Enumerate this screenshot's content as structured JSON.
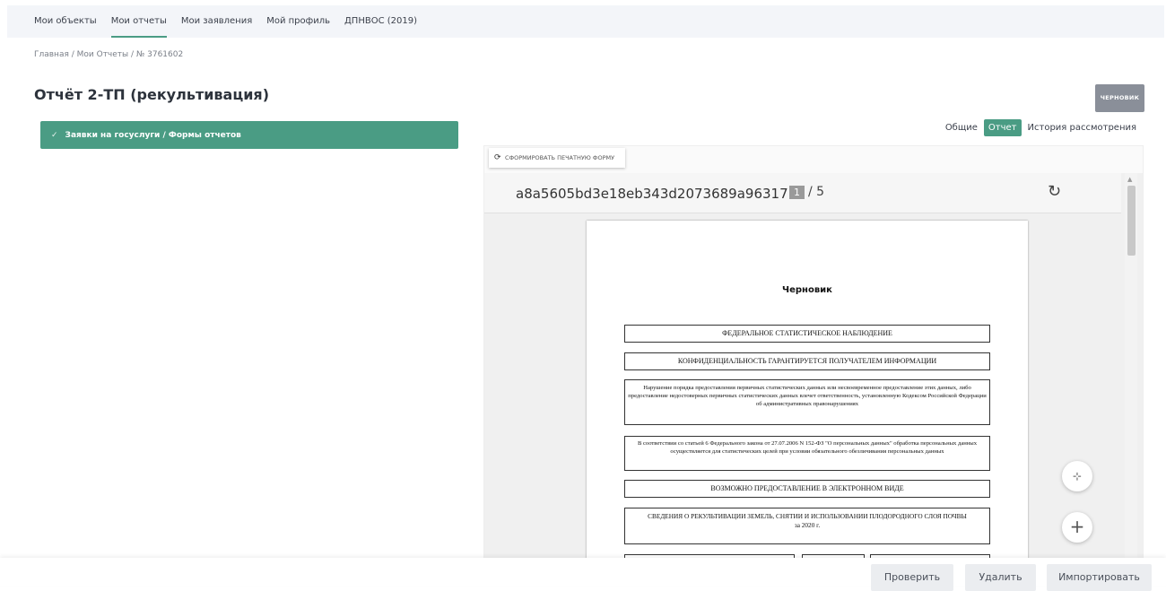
{
  "nav": {
    "items": [
      {
        "label": "Мои объекты"
      },
      {
        "label": "Мои отчеты"
      },
      {
        "label": "Мои заявления"
      },
      {
        "label": "Мой профиль"
      },
      {
        "label": "ДПНВОС (2019)"
      }
    ],
    "active_index": 1
  },
  "breadcrumb": "Главная / Мои Отчеты / № 3761602",
  "page_title": "Отчёт 2-ТП (рекультивация)",
  "status_button": "ЧЕРНОВИК",
  "section_bar": {
    "label": "Заявки на госуслуги / Формы отчетов",
    "icon": "check-icon"
  },
  "tabs": [
    {
      "label": "Общие"
    },
    {
      "label": "Отчет",
      "active": true
    },
    {
      "label": "История рассмотрения"
    }
  ],
  "viewer": {
    "generate_button": "СФОРМИРОВАТЬ ПЕЧАТНУЮ ФОРМУ",
    "document_id": "a8a5605bd3e18eb343d2073689a96317",
    "current_page": "1",
    "total_pages": "/ 5",
    "document": {
      "watermark_title": "Черновик",
      "box1": "ФЕДЕРАЛЬНОЕ СТАТИСТИЧЕСКОЕ НАБЛЮДЕНИЕ",
      "box2": "КОНФИДЕНЦИАЛЬНОСТЬ ГАРАНТИРУЕТСЯ ПОЛУЧАТЕЛЕМ ИНФОРМАЦИИ",
      "box3": "Нарушение порядка предоставления первичных статистических данных или несвоевременное предоставление этих данных, либо предоставление недостоверных первичных статистических данных влечет ответственность, установленную Кодексом Российской Федерации об административных правонарушениях",
      "box4": "В соответствии со статьей 6 Федерального закона от 27.07.2006 N 152-ФЗ \"О персональных данных\" обработка персональных данных осуществляется для статистических целей при условии обязательного обезличивания персональных данных",
      "box5": "ВОЗМОЖНО ПРЕДОСТАВЛЕНИЕ В ЭЛЕКТРОННОМ ВИДЕ",
      "box6_line1": "СВЕДЕНИЯ О РЕКУЛЬТИВАЦИИ ЗЕМЕЛЬ, СНЯТИИ И ИСПОЛЬЗОВАНИИ ПЛОДОРОДНОГО СЛОЯ ПОЧВЫ",
      "box6_line2": "за 2020 г."
    }
  },
  "actions": {
    "check": "Проверить",
    "delete": "Удалить",
    "import": "Импортировать"
  }
}
